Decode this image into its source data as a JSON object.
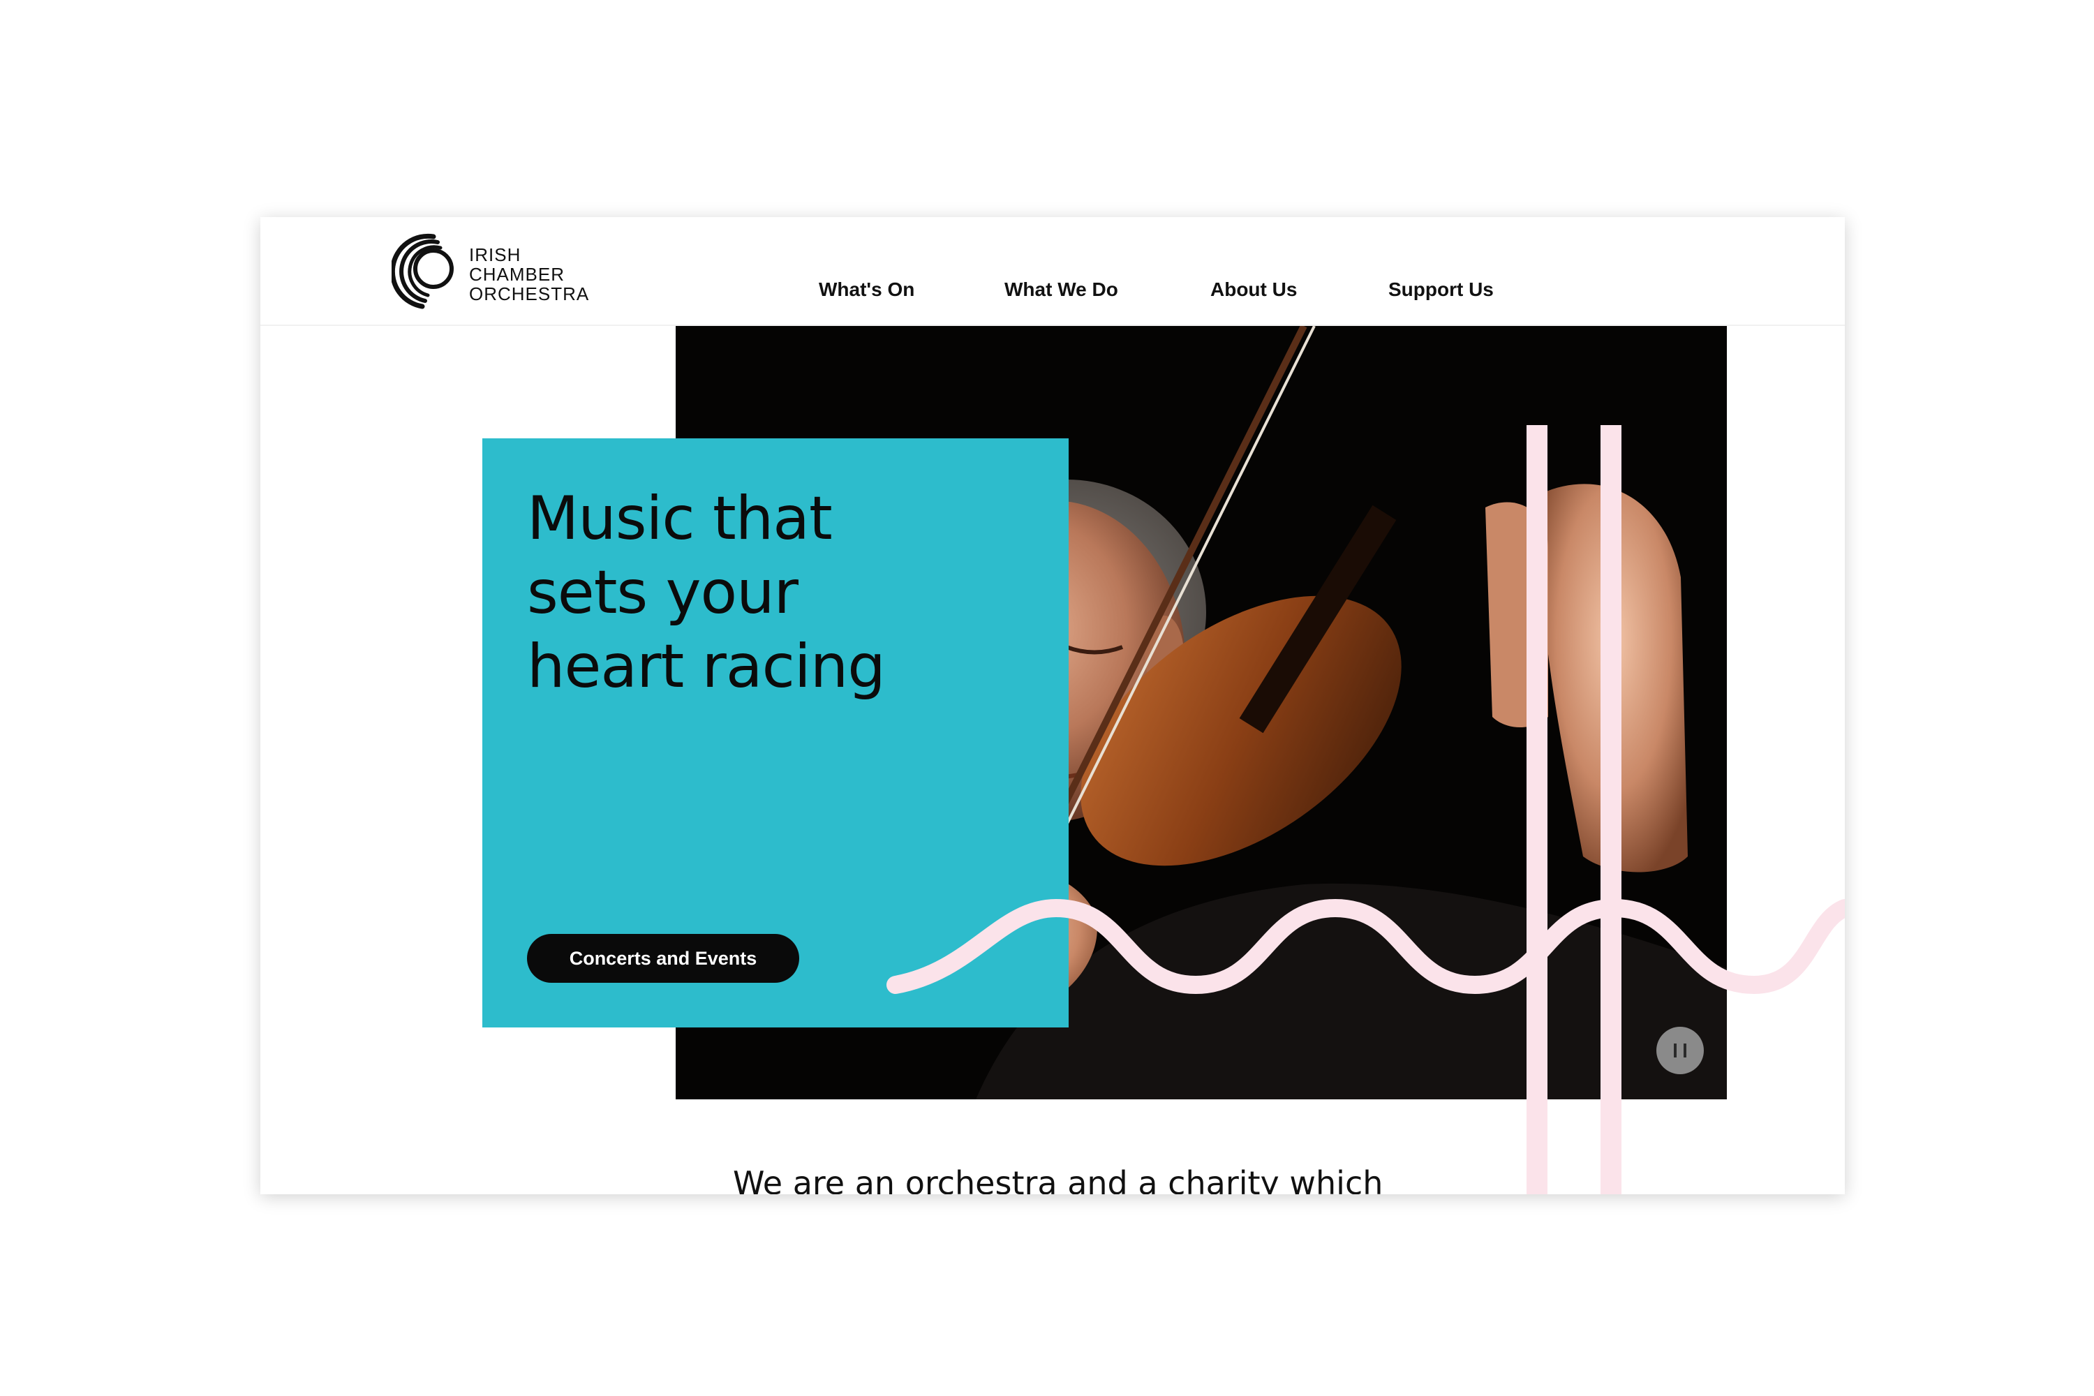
{
  "logo": {
    "lines": [
      "IRISH",
      "CHAMBER",
      "ORCHESTRA"
    ],
    "icon": "concentric-arcs-logo-icon"
  },
  "nav": {
    "items": [
      {
        "label": "What's On"
      },
      {
        "label": "What We Do"
      },
      {
        "label": "About Us"
      },
      {
        "label": "Support Us"
      }
    ]
  },
  "hero": {
    "headline_lines": [
      "Music that",
      "sets your",
      "heart racing"
    ],
    "cta_label": "Concerts and Events",
    "photo_description_icon": "violinist-photo",
    "pause_icon": "pause-icon"
  },
  "intro": {
    "text": "We are an orchestra and a charity which"
  },
  "colors": {
    "accent_teal": "#2dbccc",
    "accent_pink": "#fbe3ea",
    "text_dark": "#0b0b0b",
    "button_bg": "#0a0a0a"
  }
}
